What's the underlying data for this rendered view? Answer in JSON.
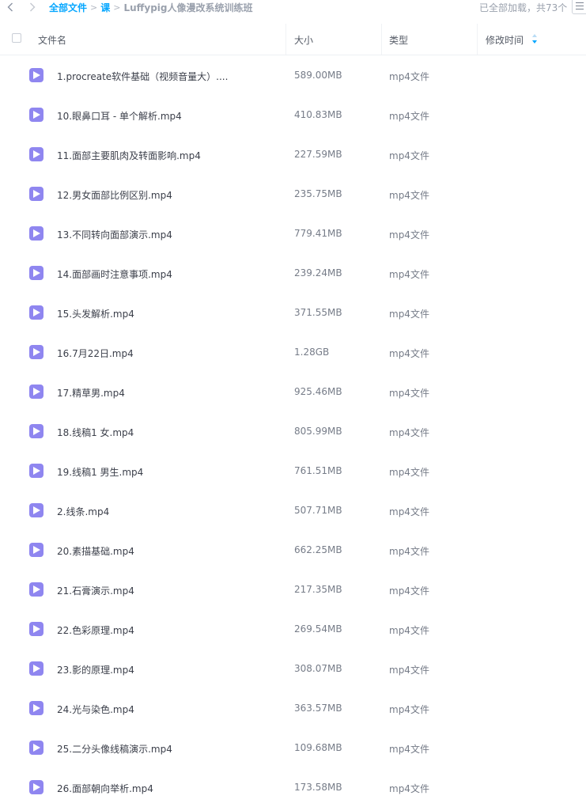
{
  "nav": {
    "back_icon": "chevron-left-icon",
    "forward_icon": "chevron-right-icon"
  },
  "breadcrumb": {
    "root": "全部文件",
    "separator": ">",
    "folder": "课",
    "current": "Luffypig人像漫改系统训练班"
  },
  "status": {
    "loaded_text": "已全部加载，共73个"
  },
  "columns": {
    "name": "文件名",
    "size": "大小",
    "type": "类型",
    "modified": "修改时间"
  },
  "colors": {
    "accent": "#06a7ff",
    "video_icon": "#8f86f0"
  },
  "files": [
    {
      "name": "1.procreate软件基础（视频音量大）....",
      "size": "589.00MB",
      "type": "mp4文件"
    },
    {
      "name": "10.眼鼻口耳 - 单个解析.mp4",
      "size": "410.83MB",
      "type": "mp4文件"
    },
    {
      "name": "11.面部主要肌肉及转面影响.mp4",
      "size": "227.59MB",
      "type": "mp4文件"
    },
    {
      "name": "12.男女面部比例区别.mp4",
      "size": "235.75MB",
      "type": "mp4文件"
    },
    {
      "name": "13.不同转向面部演示.mp4",
      "size": "779.41MB",
      "type": "mp4文件"
    },
    {
      "name": "14.面部画时注意事项.mp4",
      "size": "239.24MB",
      "type": "mp4文件"
    },
    {
      "name": "15.头发解析.mp4",
      "size": "371.55MB",
      "type": "mp4文件"
    },
    {
      "name": "16.7月22日.mp4",
      "size": "1.28GB",
      "type": "mp4文件"
    },
    {
      "name": "17.精草男.mp4",
      "size": "925.46MB",
      "type": "mp4文件"
    },
    {
      "name": "18.线稿1 女.mp4",
      "size": "805.99MB",
      "type": "mp4文件"
    },
    {
      "name": "19.线稿1 男生.mp4",
      "size": "761.51MB",
      "type": "mp4文件"
    },
    {
      "name": "2.线条.mp4",
      "size": "507.71MB",
      "type": "mp4文件"
    },
    {
      "name": "20.素描基础.mp4",
      "size": "662.25MB",
      "type": "mp4文件"
    },
    {
      "name": "21.石膏演示.mp4",
      "size": "217.35MB",
      "type": "mp4文件"
    },
    {
      "name": "22.色彩原理.mp4",
      "size": "269.54MB",
      "type": "mp4文件"
    },
    {
      "name": "23.影的原理.mp4",
      "size": "308.07MB",
      "type": "mp4文件"
    },
    {
      "name": "24.光与染色.mp4",
      "size": "363.57MB",
      "type": "mp4文件"
    },
    {
      "name": "25.二分头像线稿演示.mp4",
      "size": "109.68MB",
      "type": "mp4文件"
    },
    {
      "name": "26.面部朝向举析.mp4",
      "size": "173.58MB",
      "type": "mp4文件"
    }
  ]
}
